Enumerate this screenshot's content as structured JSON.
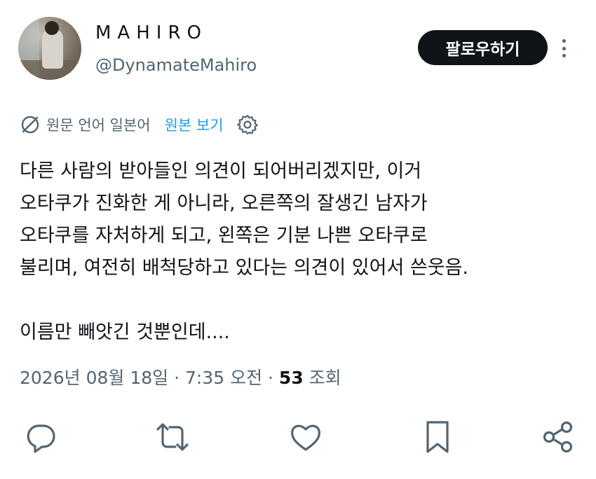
{
  "author": {
    "display_name": "MAHIRO",
    "handle": "@DynamateMahiro"
  },
  "header": {
    "follow_label": "팔로우하기"
  },
  "translation": {
    "label": "원문 언어 일본어",
    "view_original": "원본 보기"
  },
  "post": {
    "lines": [
      "다른 사람의 받아들인 의견이 되어버리겠지만, 이거",
      "오타쿠가 진화한 게 아니라, 오른쪽의 잘생긴 남자가",
      "오타쿠를 자처하게 되고, 왼쪽은 기분 나쁜 오타쿠로",
      "불리며, 여전히 배척당하고 있다는 의견이 있어서 쓴웃음."
    ],
    "last_line": "이름만 빼앗긴 것뿐인데...."
  },
  "meta": {
    "timestamp": "2026년 08월 18일 · 7:35 오전 ·",
    "views_count": "53",
    "views_label": "조회"
  },
  "icons": [
    "globe-slash-icon",
    "gear-icon",
    "more-icon",
    "reply-icon",
    "repost-icon",
    "like-icon",
    "bookmark-icon",
    "share-icon"
  ],
  "colors": {
    "text": "#0f1419",
    "secondary": "#536471",
    "link": "#1d9bf0",
    "button_bg": "#0f1419"
  }
}
